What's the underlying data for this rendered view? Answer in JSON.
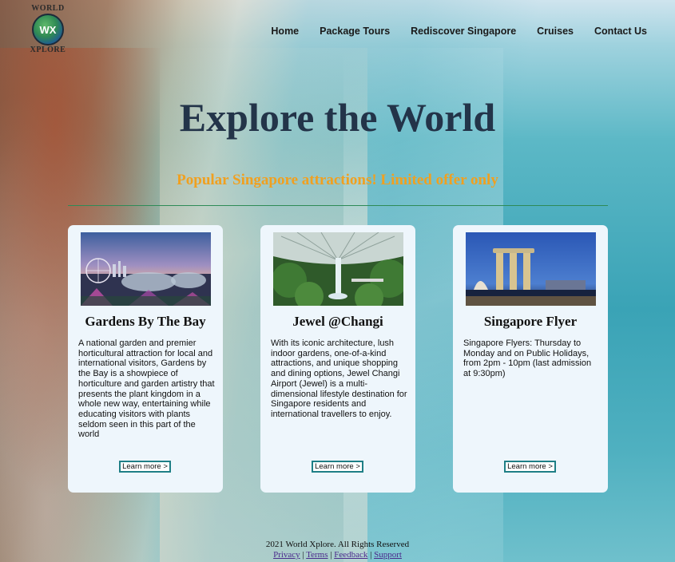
{
  "logo": {
    "top_text": "WORLD",
    "mark": "WX",
    "bottom_text": "XPLORE"
  },
  "nav": {
    "items": [
      "Home",
      "Package Tours",
      "Rediscover Singapore",
      "Cruises",
      "Contact Us"
    ]
  },
  "hero": {
    "title": "Explore the World",
    "subtitle": "Popular Singapore attractions! Limited offer only"
  },
  "cards": [
    {
      "title": "Gardens By The Bay",
      "text": "A national garden and premier horticultural attraction for local and international visitors, Gardens by the Bay is a showpiece of horticulture and garden artistry that presents the plant kingdom in a whole new way, entertaining while educating visitors with plants seldom seen in this part of the world",
      "button": "Learn more >"
    },
    {
      "title": "Jewel @Changi",
      "text": "With its iconic architecture, lush indoor gardens, one-of-a-kind attractions, and unique shopping and dining options, Jewel Changi Airport (Jewel) is a multi-dimensional lifestyle destination for Singapore residents and international travellers to enjoy.",
      "button": "Learn more >"
    },
    {
      "title": "Singapore Flyer",
      "text": "Singapore Flyers: Thursday to Monday and on Public Holidays, from 2pm - 10pm (last admission at 9:30pm)",
      "button": "Learn more >"
    }
  ],
  "footer": {
    "copyright": "2021 World Xplore. All Rights Reserved",
    "links": [
      "Privacy",
      "Terms",
      "Feedback",
      "Support"
    ],
    "separator": "|"
  },
  "colors": {
    "accent_orange": "#f0a020",
    "title_navy": "#233449",
    "button_border": "#1f7f86",
    "card_bg": "#eef6fc",
    "link_purple": "#4b2b8c"
  }
}
